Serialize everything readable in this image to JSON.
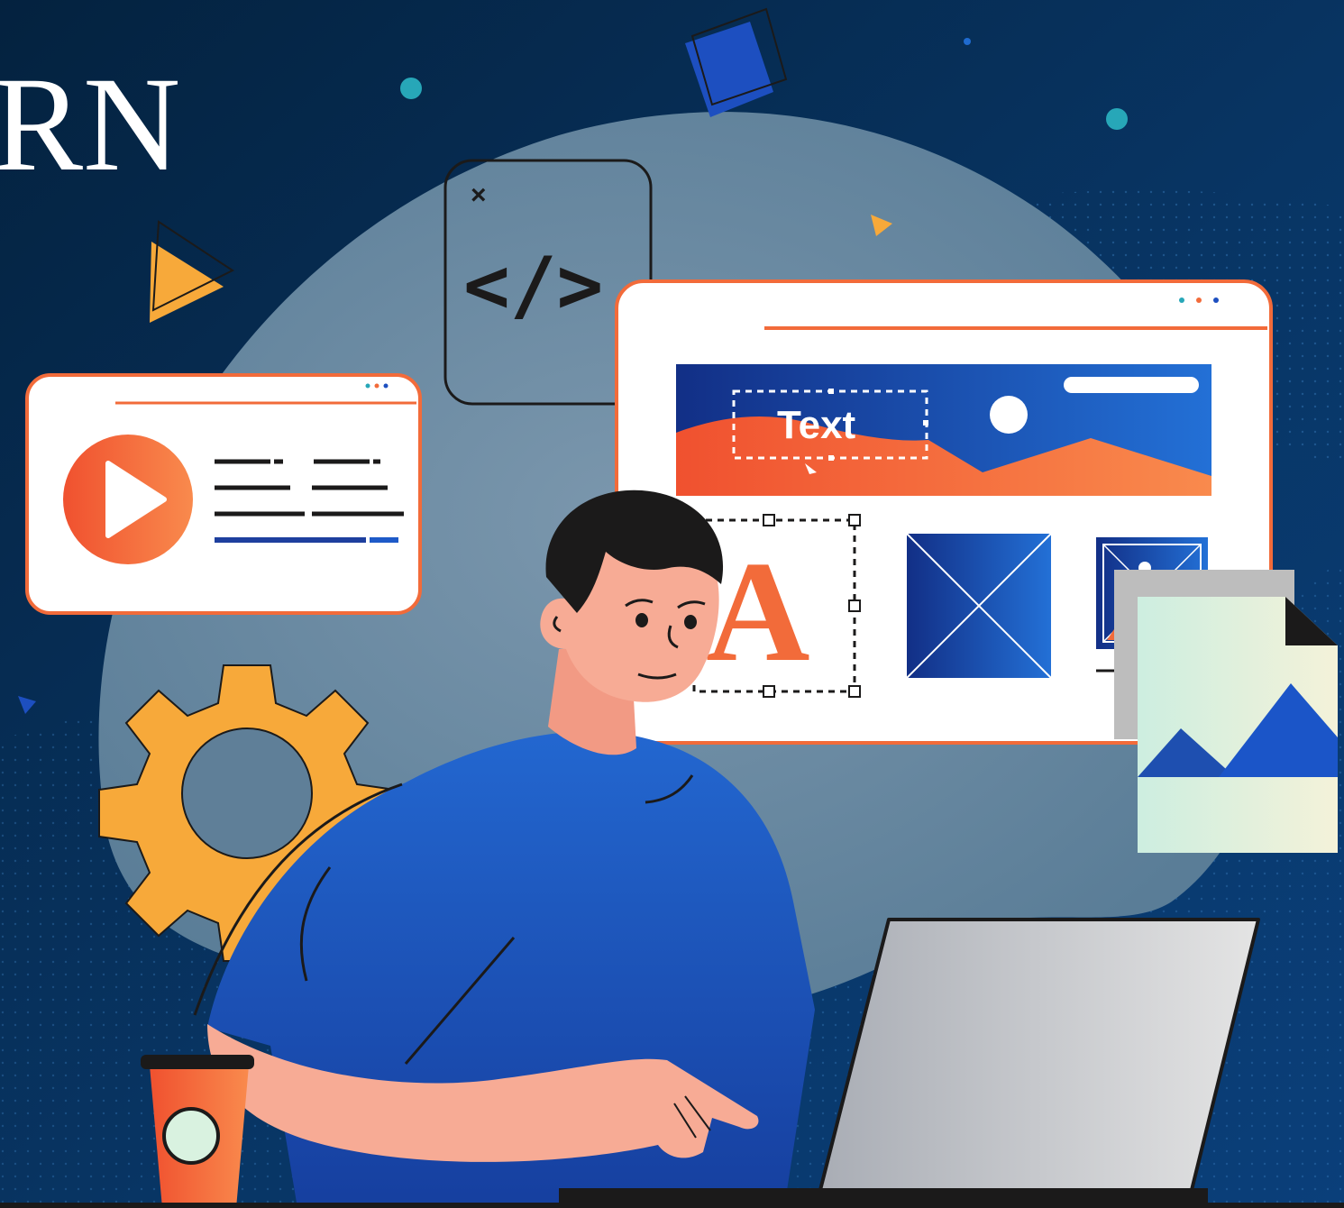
{
  "heading": {
    "partial_title": "RN"
  },
  "code_card": {
    "close_glyph": "×",
    "code_glyph": "</>"
  },
  "editor_window": {
    "text_block_label": "Text",
    "glyph_letter": "A"
  },
  "colors": {
    "background": "#062a4a",
    "accent_orange": "#f26b3a",
    "brand_blue": "#1e4fb0",
    "teal": "#27a7b8",
    "gear_yellow": "#f7a93a",
    "skin": "#f7ab95",
    "hair": "#1b1a1a"
  },
  "icons": [
    "play-icon",
    "gear-icon",
    "image-placeholder-icon",
    "code-icon",
    "close-icon",
    "cursor-icon",
    "coffee-cup-icon",
    "image-file-icon"
  ]
}
